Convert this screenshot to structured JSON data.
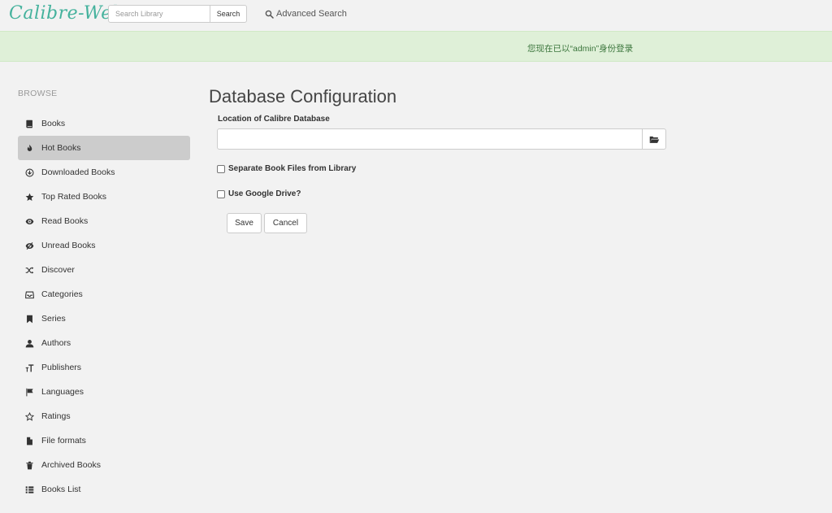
{
  "brand": "Calibre-Web",
  "search": {
    "placeholder": "Search Library",
    "button_label": "Search"
  },
  "advanced_search": {
    "label": "Advanced Search",
    "icon": "search-icon"
  },
  "alert": {
    "text": "您现在已以“admin”身份登录",
    "color": "#3c763d"
  },
  "sidebar": {
    "heading": "BROWSE",
    "active_index": 1,
    "items": [
      {
        "label": "Books",
        "icon": "book-icon"
      },
      {
        "label": "Hot Books",
        "icon": "fire-icon"
      },
      {
        "label": "Downloaded Books",
        "icon": "download-icon"
      },
      {
        "label": "Top Rated Books",
        "icon": "star-icon"
      },
      {
        "label": "Read Books",
        "icon": "eye-icon"
      },
      {
        "label": "Unread Books",
        "icon": "eye-slash-icon"
      },
      {
        "label": "Discover",
        "icon": "shuffle-icon"
      },
      {
        "label": "Categories",
        "icon": "inbox-icon"
      },
      {
        "label": "Series",
        "icon": "bookmark-icon"
      },
      {
        "label": "Authors",
        "icon": "user-icon"
      },
      {
        "label": "Publishers",
        "icon": "text-size-icon"
      },
      {
        "label": "Languages",
        "icon": "flag-icon"
      },
      {
        "label": "Ratings",
        "icon": "star-outline-icon"
      },
      {
        "label": "File formats",
        "icon": "file-icon"
      },
      {
        "label": "Archived Books",
        "icon": "trash-icon"
      },
      {
        "label": "Books List",
        "icon": "list-icon"
      }
    ]
  },
  "main": {
    "title": "Database Configuration",
    "db_location_label": "Location of Calibre Database",
    "db_location_value": "",
    "folder_icon": "folder-open-icon",
    "separate_files_label": "Separate Book Files from Library",
    "separate_files_checked": false,
    "google_drive_label": "Use Google Drive?",
    "google_drive_checked": false,
    "save_label": "Save",
    "cancel_label": "Cancel"
  },
  "colors": {
    "brand": "#45b29d",
    "active_item": "#cccccc",
    "alert_bg": "#dff0d8"
  }
}
